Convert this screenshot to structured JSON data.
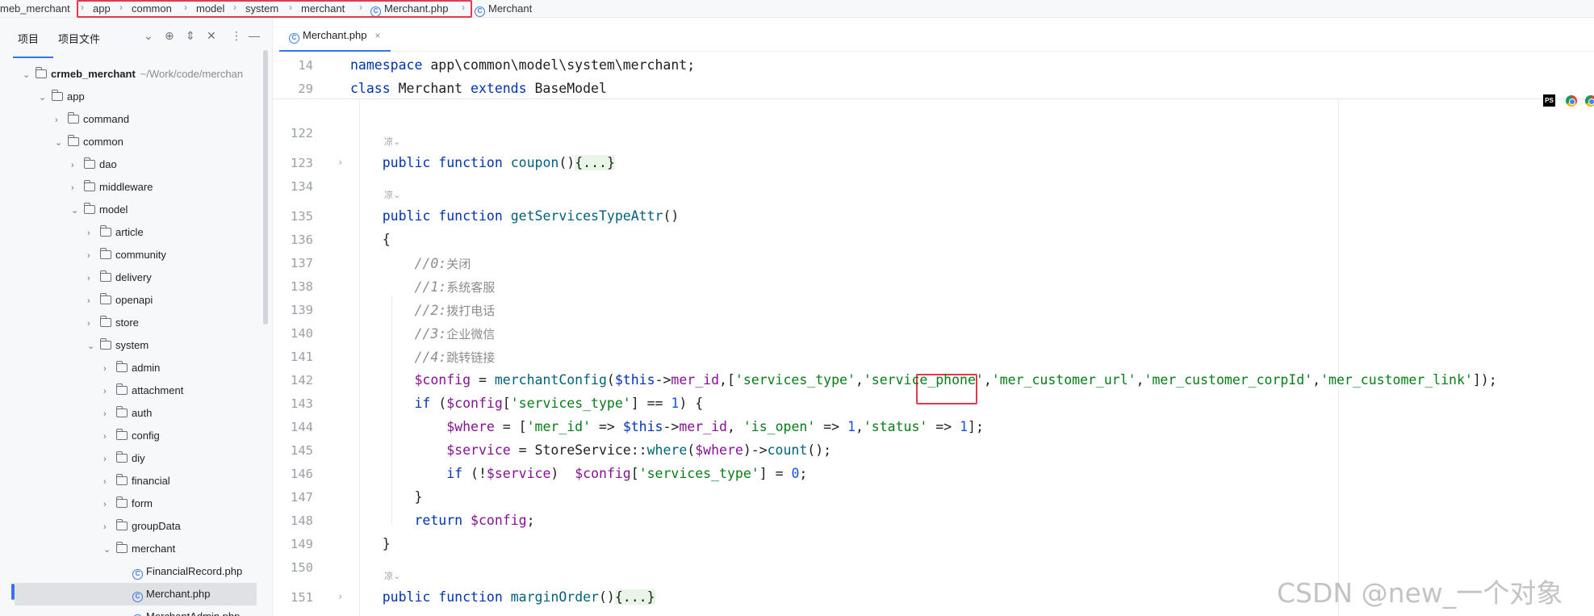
{
  "breadcrumb": {
    "project": "meb_merchant",
    "items": [
      "app",
      "common",
      "model",
      "system",
      "merchant",
      "Merchant.php",
      "Merchant"
    ]
  },
  "project_panel": {
    "tab_project": "项目",
    "tab_files": "项目文件",
    "tree": [
      {
        "label": "crmeb_merchant",
        "sub": "~/Work/code/merchan",
        "depth": 0,
        "open": true,
        "bold": true
      },
      {
        "label": "app",
        "depth": 1,
        "open": true
      },
      {
        "label": "command",
        "depth": 2,
        "open": false
      },
      {
        "label": "common",
        "depth": 2,
        "open": true
      },
      {
        "label": "dao",
        "depth": 3,
        "open": false
      },
      {
        "label": "middleware",
        "depth": 3,
        "open": false
      },
      {
        "label": "model",
        "depth": 3,
        "open": true
      },
      {
        "label": "article",
        "depth": 4,
        "open": false
      },
      {
        "label": "community",
        "depth": 4,
        "open": false
      },
      {
        "label": "delivery",
        "depth": 4,
        "open": false
      },
      {
        "label": "openapi",
        "depth": 4,
        "open": false
      },
      {
        "label": "store",
        "depth": 4,
        "open": false
      },
      {
        "label": "system",
        "depth": 4,
        "open": true
      },
      {
        "label": "admin",
        "depth": 5,
        "open": false
      },
      {
        "label": "attachment",
        "depth": 5,
        "open": false
      },
      {
        "label": "auth",
        "depth": 5,
        "open": false
      },
      {
        "label": "config",
        "depth": 5,
        "open": false
      },
      {
        "label": "diy",
        "depth": 5,
        "open": false
      },
      {
        "label": "financial",
        "depth": 5,
        "open": false
      },
      {
        "label": "form",
        "depth": 5,
        "open": false
      },
      {
        "label": "groupData",
        "depth": 5,
        "open": false
      },
      {
        "label": "merchant",
        "depth": 5,
        "open": true
      },
      {
        "label": "FinancialRecord.php",
        "depth": 6,
        "file": true
      },
      {
        "label": "Merchant.php",
        "depth": 6,
        "file": true,
        "selected": true
      },
      {
        "label": "MerchantAdmin.php",
        "depth": 6,
        "file": true
      }
    ]
  },
  "editor": {
    "tab_label": "Merchant.php",
    "close_glyph": "×",
    "inlay_hint": "凉⌄",
    "sticky": [
      {
        "num": "14",
        "text": "namespace app\\common\\model\\system\\merchant;"
      },
      {
        "num": "29",
        "text": "class Merchant extends BaseModel"
      }
    ],
    "lines": [
      {
        "num": "122",
        "text": ""
      },
      {
        "num": "123",
        "text": "    public function coupon(){...}"
      },
      {
        "num": "134",
        "text": ""
      },
      {
        "num": "135",
        "text": "    public function getServicesTypeAttr()"
      },
      {
        "num": "136",
        "text": "    {"
      },
      {
        "num": "137",
        "text": "        //0:关闭"
      },
      {
        "num": "138",
        "text": "        //1:系统客服"
      },
      {
        "num": "139",
        "text": "        //2:拨打电话"
      },
      {
        "num": "140",
        "text": "        //3:企业微信"
      },
      {
        "num": "141",
        "text": "        //4:跳转链接"
      },
      {
        "num": "142",
        "text": "        $config = merchantConfig($this->mer_id,['services_type','service_phone','mer_customer_url','mer_customer_corpId','mer_customer_link']);"
      },
      {
        "num": "143",
        "text": "        if ($config['services_type'] == 1) {"
      },
      {
        "num": "144",
        "text": "            $where = ['mer_id' => $this->mer_id, 'is_open' => 1,'status' => 1];"
      },
      {
        "num": "145",
        "text": "            $service = StoreService::where($where)->count();"
      },
      {
        "num": "146",
        "text": "            if (!$service)  $config['services_type'] = 0;"
      },
      {
        "num": "147",
        "text": "        }"
      },
      {
        "num": "148",
        "text": "        return $config;"
      },
      {
        "num": "149",
        "text": "    }"
      },
      {
        "num": "150",
        "text": ""
      },
      {
        "num": "151",
        "text": "    public function marginOrder(){...}"
      }
    ]
  },
  "browser_icons": {
    "ps": "PS"
  },
  "watermark": "CSDN @new_一个对象",
  "colors": {
    "highlight_box": "#e5384a",
    "accent": "#3574f0",
    "keyword": "#0033b3",
    "string": "#067d17",
    "number": "#1750eb"
  }
}
